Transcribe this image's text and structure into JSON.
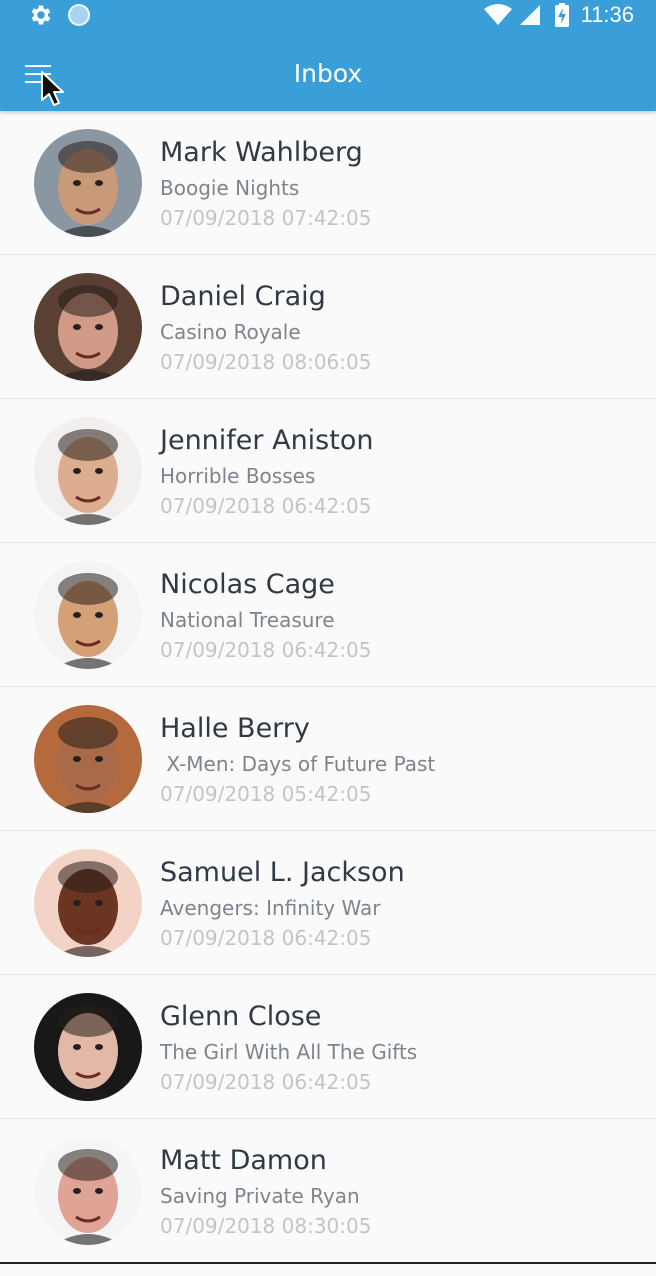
{
  "status_bar": {
    "time": "11:36",
    "icons": [
      "gear-icon",
      "circle-icon",
      "wifi-icon",
      "signal-icon",
      "battery-charging-icon"
    ]
  },
  "app_bar": {
    "title": "Inbox",
    "menu_icon": "hamburger-menu-icon",
    "color": "#3a9fd9"
  },
  "inbox": {
    "items": [
      {
        "name": "Mark Wahlberg",
        "film": "Boogie Nights",
        "date": "07/09/2018 07:42:05",
        "avatar_color": "#8a97a3",
        "skin": "#c99a7a"
      },
      {
        "name": "Daniel Craig",
        "film": "Casino Royale",
        "date": "07/09/2018 08:06:05",
        "avatar_color": "#5a4032",
        "skin": "#d19a86"
      },
      {
        "name": "Jennifer Aniston",
        "film": "Horrible Bosses",
        "date": "07/09/2018 06:42:05",
        "avatar_color": "#f2f0ee",
        "skin": "#dcae8f"
      },
      {
        "name": "Nicolas Cage",
        "film": "National Treasure",
        "date": "07/09/2018 06:42:05",
        "avatar_color": "#f4f4f4",
        "skin": "#d6a077"
      },
      {
        "name": "Halle Berry",
        "film": " X-Men: Days of Future Past",
        "date": "07/09/2018 05:42:05",
        "avatar_color": "#b46a3c",
        "skin": "#a86a48"
      },
      {
        "name": "Samuel L. Jackson",
        "film": "Avengers: Infinity War",
        "date": "07/09/2018 06:42:05",
        "avatar_color": "#f3d3c6",
        "skin": "#6b3521"
      },
      {
        "name": "Glenn Close",
        "film": "The Girl With All The Gifts",
        "date": "07/09/2018 06:42:05",
        "avatar_color": "#181818",
        "skin": "#e2b9a6"
      },
      {
        "name": "Matt Damon",
        "film": "Saving Private Ryan",
        "date": "07/09/2018 08:30:05",
        "avatar_color": "#f5f5f5",
        "skin": "#e0a496"
      }
    ]
  }
}
